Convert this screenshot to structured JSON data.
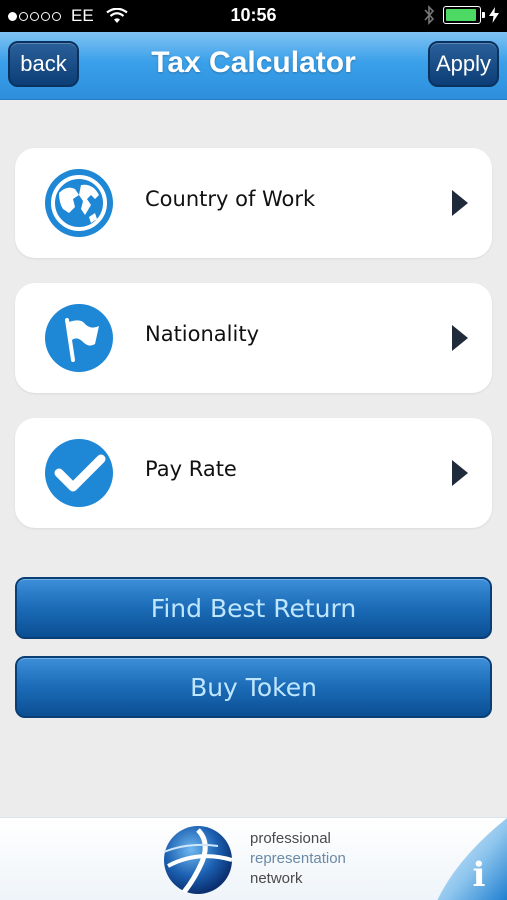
{
  "status_bar": {
    "signal_dots_filled": 1,
    "signal_dots_total": 5,
    "carrier": "EE",
    "time": "10:56",
    "battery_level": 0.95,
    "battery_color": "#4cd964"
  },
  "nav": {
    "back_label": "back",
    "title": "Tax Calculator",
    "apply_label": "Apply"
  },
  "options": [
    {
      "label": "Country of Work",
      "icon": "globe-icon"
    },
    {
      "label": "Nationality",
      "icon": "flag-icon"
    },
    {
      "label": "Pay Rate",
      "icon": "checkmark-icon"
    }
  ],
  "actions": {
    "find_best_return": "Find Best Return",
    "buy_token": "Buy Token"
  },
  "footer": {
    "logo_line1": "professional",
    "logo_line2": "representation",
    "logo_line3": "network",
    "info_glyph": "i"
  },
  "colors": {
    "accent": "#1e87d6",
    "nav_gradient_top": "#7fc2f2",
    "button_dark": "#0b4f93",
    "button_text": "#bfe6ff"
  }
}
